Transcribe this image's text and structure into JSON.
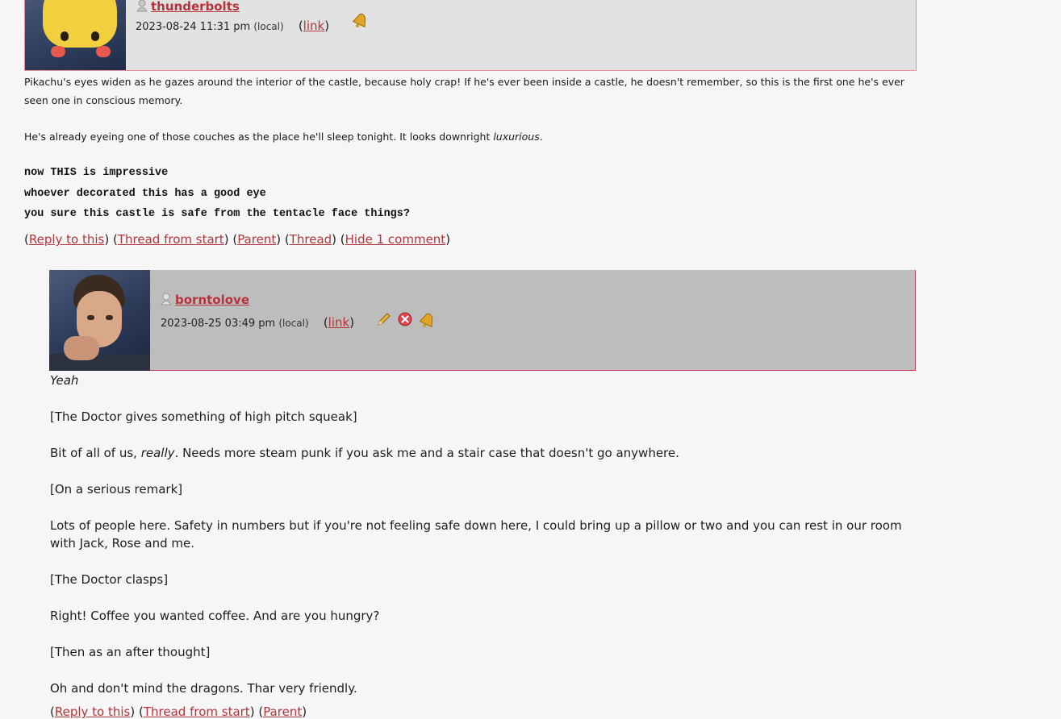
{
  "comment1": {
    "username": "thunderbolts",
    "date": "2023-08-24 11:31 pm",
    "timezone": "(local)",
    "link_label": "link",
    "icons": [
      "bell-icon"
    ],
    "paragraphs": [
      "Pikachu's eyes widen as he gazes around the interior of the castle, because holy crap! If he's ever been inside a castle, he doesn't remember, so this is the first one he's ever seen one in conscious memory.",
      "He's already eyeing one of those couches as the place he'll sleep tonight. It looks downright ",
      "luxurious",
      "."
    ],
    "mono_lines": [
      "now THIS is impressive",
      "whoever decorated this has a good eye",
      "you sure this castle is safe from the tentacle face things?"
    ],
    "actions": [
      "Reply to this",
      "Thread from start",
      "Parent",
      "Thread",
      "Hide 1 comment"
    ]
  },
  "comment2": {
    "username": "borntolove",
    "date": "2023-08-25 03:49 pm",
    "timezone": "(local)",
    "link_label": "link",
    "icons": [
      "edit-pencil-icon",
      "delete-icon",
      "bell-icon"
    ],
    "lines": {
      "l1": "Yeah",
      "l2": "[The Doctor gives something of high pitch squeak]",
      "l3a": "Bit of all of us, ",
      "l3b": "really",
      "l3c": ". Needs more steam punk if you ask me and a stair case that doesn't go anywhere.",
      "l4": "[On a serious remark]",
      "l5": "Lots of people here. Safety in numbers but if you're not feeling safe down here, I could bring up a pillow or two and you can rest in our room with Jack, Rose and me.",
      "l6": "[The Doctor clasps]",
      "l7": "Right! Coffee you wanted coffee. And are you hungry?",
      "l8": "[Then as an after thought]",
      "l9": "Oh and don't mind the dragons. Thar very friendly."
    },
    "actions": [
      "Reply to this",
      "Thread from start",
      "Parent"
    ]
  },
  "colors": {
    "link": "#b5333b",
    "header1_bg": "#e2e2e2",
    "header2_bg": "#bdbdbd",
    "page_bg": "#f6f6f6"
  }
}
